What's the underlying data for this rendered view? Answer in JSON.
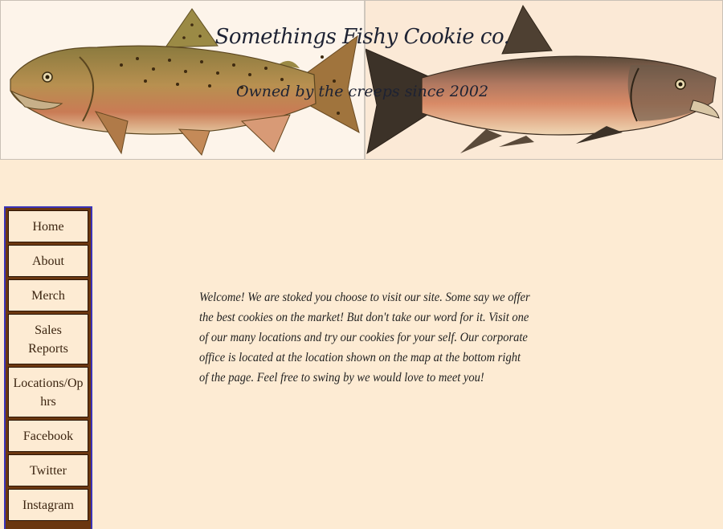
{
  "header": {
    "title": "Somethings Fishy Cookie co.",
    "tagline": "Owned by the creeps since 2002"
  },
  "nav": {
    "items": [
      {
        "label": "Home"
      },
      {
        "label": "About"
      },
      {
        "label": "Merch"
      },
      {
        "label": "Sales Reports"
      },
      {
        "label": "Locations/Op hrs"
      },
      {
        "label": "Facebook"
      },
      {
        "label": "Twitter"
      },
      {
        "label": "Instagram"
      }
    ]
  },
  "main": {
    "welcome_text": "Welcome! We are stoked you choose to visit our site. Some say we offer the best cookies on the market! But don't take our word for it. Visit one of our many locations and try our cookies for your self. Our corporate office is located at the location shown on the map at the bottom right of the page. Feel free to swing by we would love to meet you!"
  },
  "colors": {
    "background": "#fdebd3",
    "nav_border": "#3a33b8",
    "nav_separator": "#6b3710",
    "title_text": "#1d2233"
  },
  "icons": [
    "trout-illustration",
    "salmon-illustration"
  ]
}
